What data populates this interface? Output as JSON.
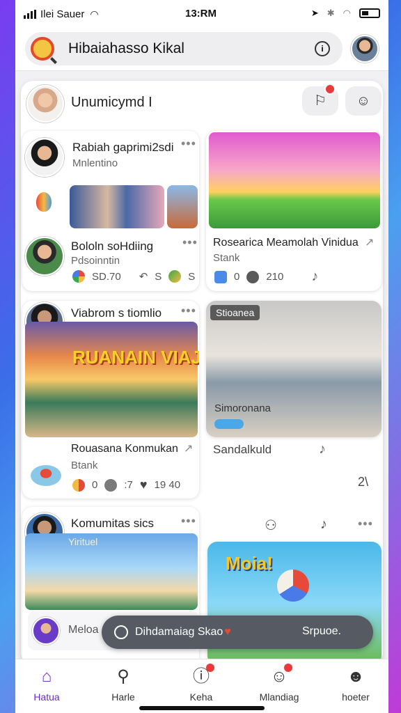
{
  "status_bar": {
    "carrier": "Ilei Sauer",
    "time": "13:RM"
  },
  "search_bar": {
    "title": "Hibaiahasso Kikal"
  },
  "main_card": {
    "user_name": "Unumicymd I"
  },
  "posts": [
    {
      "title": "Rabiah gaprimi2sdi",
      "subtitle": "Mnlentino"
    },
    {
      "title": "Bololn soHdiing",
      "subtitle": "Pdsoinntin",
      "stat_1": "SD.70",
      "stat_2": "S",
      "stat_3": "S"
    },
    {
      "title": "Rosearica Meamolah Vinidua",
      "subtitle": "Stank",
      "stat_1": "0",
      "stat_2": "210"
    },
    {
      "title": "Viabrom s tiomlio",
      "image_caption": "RUANAIN VIAJ!"
    },
    {
      "title": "Stioanea",
      "image_caption": "Simoronana"
    },
    {
      "title": "Rouasana Konmukan",
      "subtitle": "Btank",
      "stat_1": "0",
      "stat_2": ":7",
      "stat_3": "19 40"
    },
    {
      "title": "Sandalkuld",
      "stat_1": "2\\"
    },
    {
      "title": "Komumitas sics",
      "subtitle": "Yirituel"
    },
    {
      "image_caption": "Moia!"
    }
  ],
  "bottom_preview": {
    "label": "Meloa"
  },
  "toast": {
    "message": "Dihdamaiag Skao",
    "action": "Srpuoe."
  },
  "nav": [
    {
      "label": "Hatua",
      "icon": "home-icon",
      "active": true
    },
    {
      "label": "Harle",
      "icon": "search-icon"
    },
    {
      "label": "Keha",
      "icon": "notification-icon"
    },
    {
      "label": "Mlandiag",
      "icon": "chat-icon"
    },
    {
      "label": "hoeter",
      "icon": "profile-icon"
    }
  ],
  "colors": {
    "accent": "#7a30d0",
    "badge": "#e83a3a",
    "toast": "#565a62"
  }
}
